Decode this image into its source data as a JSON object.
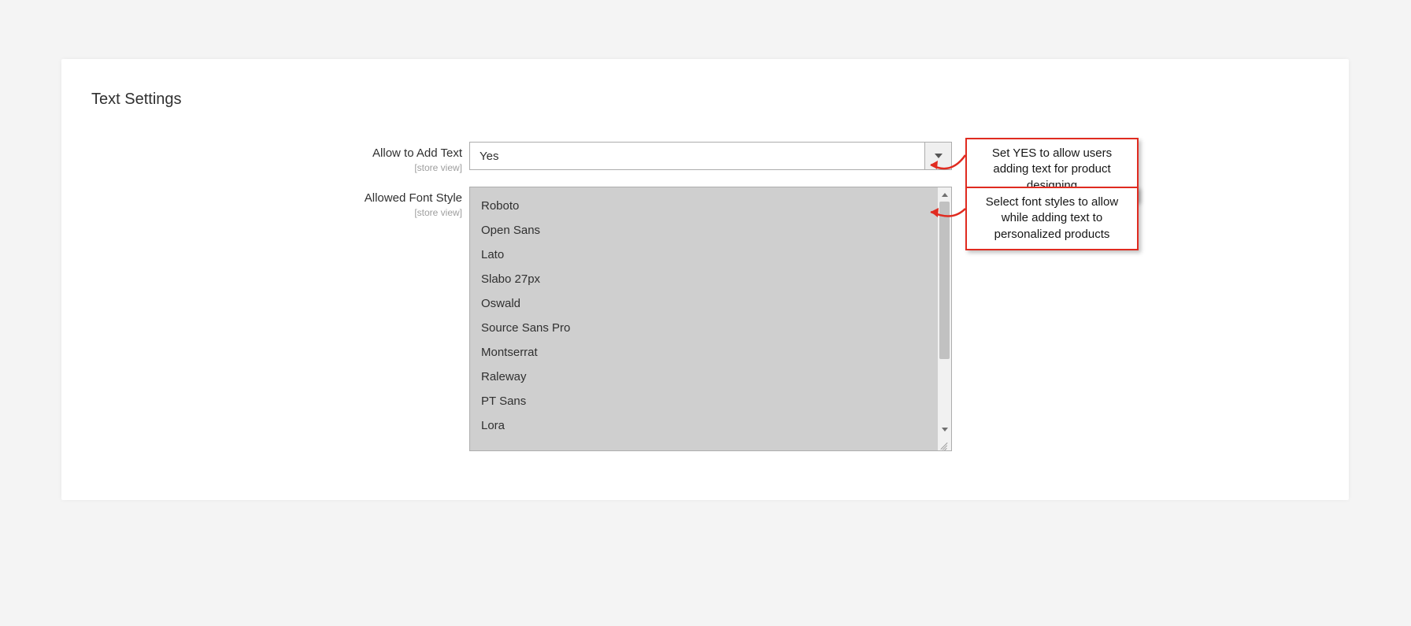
{
  "section_title": "Text Settings",
  "fields": {
    "allow_add_text": {
      "label": "Allow to Add Text",
      "scope": "[store view]",
      "value": "Yes"
    },
    "allowed_font_style": {
      "label": "Allowed Font Style",
      "scope": "[store view]",
      "options": [
        "Roboto",
        "Open Sans",
        "Lato",
        "Slabo 27px",
        "Oswald",
        "Source Sans Pro",
        "Montserrat",
        "Raleway",
        "PT Sans",
        "Lora"
      ]
    }
  },
  "callouts": {
    "add_text": "Set YES to allow users adding text for product designing",
    "font_style": "Select font styles to allow while adding text to personalized products"
  }
}
